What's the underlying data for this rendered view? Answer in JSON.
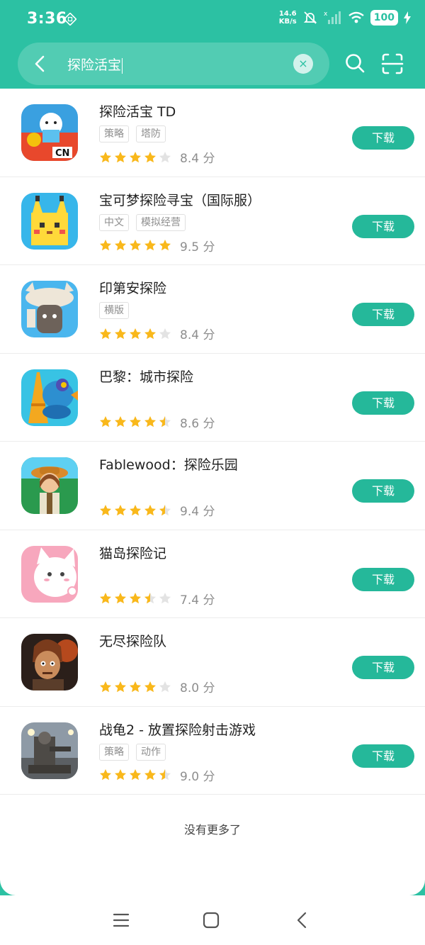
{
  "status": {
    "time": "3:36",
    "net_speed_value": "14.6",
    "net_speed_unit": "KB/s",
    "battery": "100"
  },
  "search": {
    "query": "探险活宝",
    "clear_glyph": "×"
  },
  "apps": [
    {
      "name": "探险活宝 TD",
      "tags": [
        "策略",
        "塔防"
      ],
      "rating": 4,
      "score": "8.4 分",
      "button": "下载",
      "icon": "adventure-time-td-icon"
    },
    {
      "name": "宝可梦探险寻宝（国际服）",
      "tags": [
        "中文",
        "模拟经营"
      ],
      "rating": 5,
      "score": "9.5 分",
      "button": "下载",
      "icon": "pokemon-quest-icon"
    },
    {
      "name": "印第安探险",
      "tags": [
        "横版"
      ],
      "rating": 4,
      "score": "8.4 分",
      "button": "下载",
      "icon": "indian-adventure-icon"
    },
    {
      "name": "巴黎：城市探险",
      "tags": [],
      "rating": 4.5,
      "score": "8.6 分",
      "button": "下载",
      "icon": "paris-city-adventure-icon"
    },
    {
      "name": "Fablewood：探险乐园",
      "tags": [],
      "rating": 4.5,
      "score": "9.4 分",
      "button": "下载",
      "icon": "fablewood-icon"
    },
    {
      "name": "猫岛探险记",
      "tags": [],
      "rating": 3.5,
      "score": "7.4 分",
      "button": "下载",
      "icon": "cat-island-icon"
    },
    {
      "name": "无尽探险队",
      "tags": [],
      "rating": 4,
      "score": "8.0 分",
      "button": "下载",
      "icon": "endless-expedition-icon"
    },
    {
      "name": "战龟2 - 放置探险射击游戏",
      "tags": [
        "策略",
        "动作"
      ],
      "rating": 4.5,
      "score": "9.0 分",
      "button": "下载",
      "icon": "war-tortoise-2-icon"
    }
  ],
  "footer_text": "没有更多了",
  "colors": {
    "accent": "#2cc1a3",
    "button": "#25b89a",
    "star": "#f9b81b",
    "star_empty": "#e3e3e3"
  }
}
